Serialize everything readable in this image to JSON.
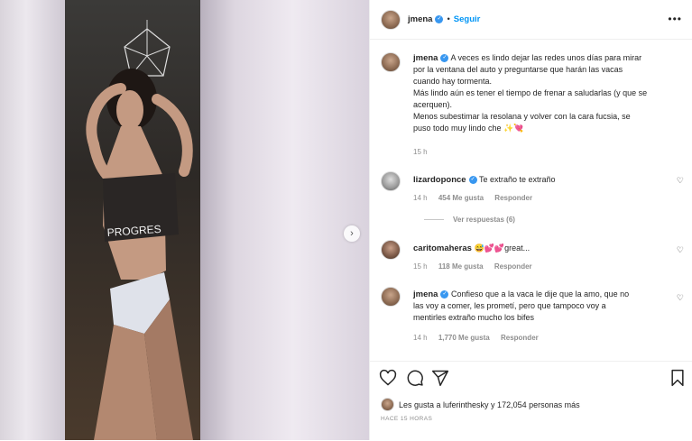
{
  "header": {
    "username": "jmena",
    "separator": "•",
    "follow_label": "Seguir",
    "more_label": "•••"
  },
  "caption": {
    "username": "jmena",
    "lines": [
      "A veces es lindo dejar las redes unos días para mirar",
      "por la ventana del auto y preguntarse que harán las vacas",
      "cuando hay tormenta.",
      "Más lindo aún es tener el tiempo de frenar a saludarlas (y que se",
      "acerquen).",
      "Menos subestimar la resolana y volver con la cara fucsia, se",
      "puso todo muy lindo che ✨💘"
    ],
    "time": "15 h"
  },
  "comments": [
    {
      "username": "lizardoponce",
      "text": "Te extraño te extraño",
      "time": "14 h",
      "likes": "454 Me gusta",
      "reply": "Responder",
      "view_replies": "Ver respuestas (6)"
    },
    {
      "username": "caritomaheras",
      "text": "😅💕💕great...",
      "time": "15 h",
      "likes": "118 Me gusta",
      "reply": "Responder"
    },
    {
      "username": "jmena",
      "lines": [
        "Confieso que a la vaca le dije que la amo, que no",
        "las voy a comer, les prometí, pero que tampoco voy a",
        "mentirles extraño mucho los bifes"
      ],
      "time": "14 h",
      "likes": "1,770 Me gusta",
      "reply": "Responder"
    }
  ],
  "actions": {
    "likes_text": "Les gusta a luferinthesky y 172,054 personas más",
    "ago": "HACE 15 HORAS"
  },
  "photo": {
    "next_label": "›",
    "top_text": "PROGRES"
  },
  "icons": {
    "heart": "heart-icon",
    "comment": "comment-icon",
    "share": "share-icon",
    "save": "bookmark-icon",
    "verified": "verified-icon"
  },
  "colors": {
    "link": "#0095f6",
    "verified": "#3897f0",
    "muted": "#8e8e8e"
  }
}
